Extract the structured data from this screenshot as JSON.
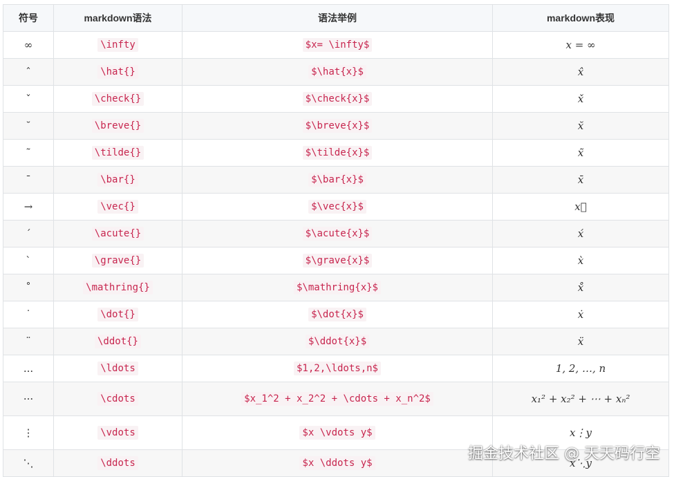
{
  "headers": [
    "符号",
    "markdown语法",
    "语法举例",
    "markdown表现"
  ],
  "rows": [
    {
      "symbol": "∞",
      "syntax": "\\infty",
      "example": "$x= \\infty$",
      "render": "x = ∞"
    },
    {
      "symbol": "ˆ",
      "syntax": "\\hat{}",
      "example": "$\\hat{x}$",
      "render": "x̂"
    },
    {
      "symbol": "ˇ",
      "syntax": "\\check{}",
      "example": "$\\check{x}$",
      "render": "x̌"
    },
    {
      "symbol": "˘",
      "syntax": "\\breve{}",
      "example": "$\\breve{x}$",
      "render": "x̆"
    },
    {
      "symbol": "˜",
      "syntax": "\\tilde{}",
      "example": "$\\tilde{x}$",
      "render": "x̃"
    },
    {
      "symbol": "¯",
      "syntax": "\\bar{}",
      "example": "$\\bar{x}$",
      "render": "x̄"
    },
    {
      "symbol": "→",
      "syntax": "\\vec{}",
      "example": "$\\vec{x}$",
      "render": "x⃗"
    },
    {
      "symbol": "´",
      "syntax": "\\acute{}",
      "example": "$\\acute{x}$",
      "render": "x́"
    },
    {
      "symbol": "`",
      "syntax": "\\grave{}",
      "example": "$\\grave{x}$",
      "render": "x̀"
    },
    {
      "symbol": "˚",
      "syntax": "\\mathring{}",
      "example": "$\\mathring{x}$",
      "render": "x̊"
    },
    {
      "symbol": "˙",
      "syntax": "\\dot{}",
      "example": "$\\dot{x}$",
      "render": "ẋ"
    },
    {
      "symbol": "¨",
      "syntax": "\\ddot{}",
      "example": "$\\ddot{x}$",
      "render": "ẍ"
    },
    {
      "symbol": "...",
      "syntax": "\\ldots",
      "example": "$1,2,\\ldots,n$",
      "render": "1, 2, …, n"
    },
    {
      "symbol": "···",
      "syntax": "\\cdots",
      "example": "$x_1^2 + x_2^2 + \\cdots + x_n^2$",
      "render": "x₁² + x₂² + ⋯ + xₙ²"
    },
    {
      "symbol": "⋮",
      "syntax": "\\vdots",
      "example": "$x \\vdots y$",
      "render": "x⋮y"
    },
    {
      "symbol": "⋱",
      "syntax": "\\ddots",
      "example": "$x \\ddots y$",
      "render": "x⋱y"
    }
  ],
  "watermark": "掘金技术社区 @ 天天码行空"
}
